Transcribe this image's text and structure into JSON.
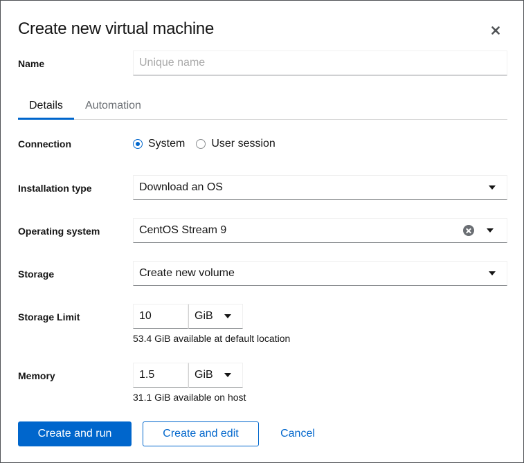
{
  "dialog": {
    "title": "Create new virtual machine",
    "close_icon": "close-icon"
  },
  "name": {
    "label": "Name",
    "value": "",
    "placeholder": "Unique name"
  },
  "tabs": [
    {
      "label": "Details",
      "active": true
    },
    {
      "label": "Automation",
      "active": false
    }
  ],
  "connection": {
    "label": "Connection",
    "options": [
      {
        "label": "System",
        "checked": true
      },
      {
        "label": "User session",
        "checked": false
      }
    ]
  },
  "installation_type": {
    "label": "Installation type",
    "value": "Download an OS"
  },
  "operating_system": {
    "label": "Operating system",
    "value": "CentOS Stream 9"
  },
  "storage": {
    "label": "Storage",
    "value": "Create new volume"
  },
  "storage_limit": {
    "label": "Storage Limit",
    "value": "10",
    "unit": "GiB",
    "helper": "53.4 GiB available at default location"
  },
  "memory": {
    "label": "Memory",
    "value": "1.5",
    "unit": "GiB",
    "helper": "31.1 GiB available on host"
  },
  "footer": {
    "create_run": "Create and run",
    "create_edit": "Create and edit",
    "cancel": "Cancel"
  },
  "colors": {
    "accent": "#0066cc",
    "text": "#151515",
    "muted": "#6a6e73"
  }
}
